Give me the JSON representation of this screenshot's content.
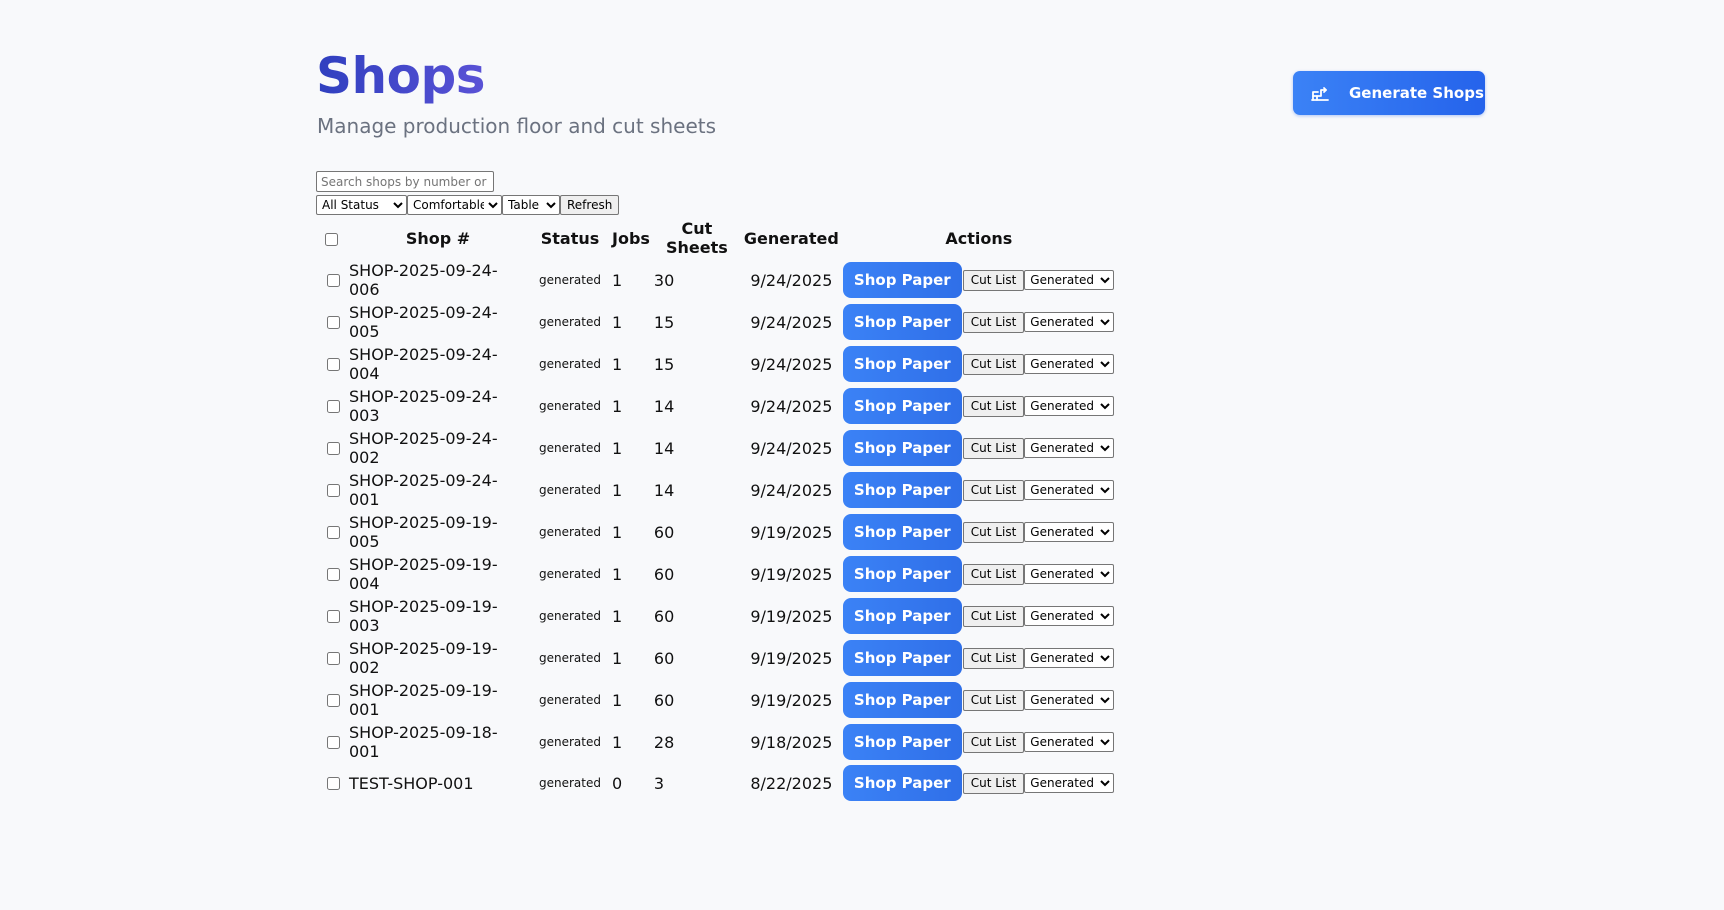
{
  "header": {
    "title": "Shops",
    "subtitle": "Manage production floor and cut sheets",
    "generate_button": {
      "label": "Generate Shops",
      "icon": "generate-icon"
    }
  },
  "controls": {
    "search_placeholder": "Search shops by number or name",
    "status_filter": {
      "selected": "All Status"
    },
    "density": {
      "selected": "Comfortable"
    },
    "view": {
      "selected": "Table"
    },
    "refresh_label": "Refresh"
  },
  "table": {
    "headers": {
      "shop": "Shop #",
      "status": "Status",
      "jobs": "Jobs",
      "cut_sheets": "Cut Sheets",
      "generated": "Generated",
      "actions": "Actions"
    },
    "action_labels": {
      "shop_paper": "Shop Paper",
      "cut_list": "Cut List",
      "status_select": "Generated"
    },
    "rows": [
      {
        "shop": "SHOP-2025-09-24-006",
        "status": "generated",
        "jobs": "1",
        "cut_sheets": "30",
        "generated": "9/24/2025"
      },
      {
        "shop": "SHOP-2025-09-24-005",
        "status": "generated",
        "jobs": "1",
        "cut_sheets": "15",
        "generated": "9/24/2025"
      },
      {
        "shop": "SHOP-2025-09-24-004",
        "status": "generated",
        "jobs": "1",
        "cut_sheets": "15",
        "generated": "9/24/2025"
      },
      {
        "shop": "SHOP-2025-09-24-003",
        "status": "generated",
        "jobs": "1",
        "cut_sheets": "14",
        "generated": "9/24/2025"
      },
      {
        "shop": "SHOP-2025-09-24-002",
        "status": "generated",
        "jobs": "1",
        "cut_sheets": "14",
        "generated": "9/24/2025"
      },
      {
        "shop": "SHOP-2025-09-24-001",
        "status": "generated",
        "jobs": "1",
        "cut_sheets": "14",
        "generated": "9/24/2025"
      },
      {
        "shop": "SHOP-2025-09-19-005",
        "status": "generated",
        "jobs": "1",
        "cut_sheets": "60",
        "generated": "9/19/2025"
      },
      {
        "shop": "SHOP-2025-09-19-004",
        "status": "generated",
        "jobs": "1",
        "cut_sheets": "60",
        "generated": "9/19/2025"
      },
      {
        "shop": "SHOP-2025-09-19-003",
        "status": "generated",
        "jobs": "1",
        "cut_sheets": "60",
        "generated": "9/19/2025"
      },
      {
        "shop": "SHOP-2025-09-19-002",
        "status": "generated",
        "jobs": "1",
        "cut_sheets": "60",
        "generated": "9/19/2025"
      },
      {
        "shop": "SHOP-2025-09-19-001",
        "status": "generated",
        "jobs": "1",
        "cut_sheets": "60",
        "generated": "9/19/2025"
      },
      {
        "shop": "SHOP-2025-09-18-001",
        "status": "generated",
        "jobs": "1",
        "cut_sheets": "28",
        "generated": "9/18/2025"
      },
      {
        "shop": "TEST-SHOP-001",
        "status": "generated",
        "jobs": "0",
        "cut_sheets": "3",
        "generated": "8/22/2025"
      }
    ]
  },
  "colors": {
    "title": "#3b46c4",
    "primary_button": "#3b82f6",
    "subtitle": "#6b7280",
    "background": "#f8f9fb"
  }
}
